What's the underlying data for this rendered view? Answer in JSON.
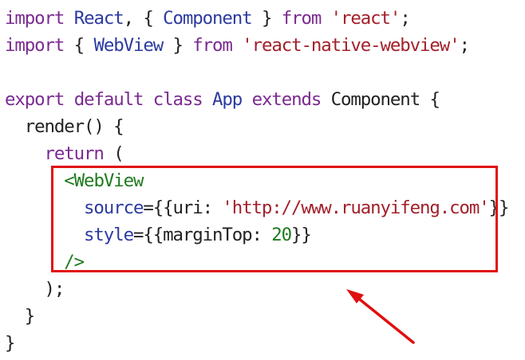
{
  "code": {
    "lines": [
      {
        "tokens": [
          {
            "t": "import",
            "c": "kw"
          },
          {
            "t": " ",
            "c": "plain"
          },
          {
            "t": "React",
            "c": "id"
          },
          {
            "t": ", { ",
            "c": "plain"
          },
          {
            "t": "Component",
            "c": "id"
          },
          {
            "t": " } ",
            "c": "plain"
          },
          {
            "t": "from",
            "c": "kw"
          },
          {
            "t": " ",
            "c": "plain"
          },
          {
            "t": "'react'",
            "c": "str"
          },
          {
            "t": ";",
            "c": "plain"
          }
        ]
      },
      {
        "tokens": [
          {
            "t": "import",
            "c": "kw"
          },
          {
            "t": " { ",
            "c": "plain"
          },
          {
            "t": "WebView",
            "c": "id"
          },
          {
            "t": " } ",
            "c": "plain"
          },
          {
            "t": "from",
            "c": "kw"
          },
          {
            "t": " ",
            "c": "plain"
          },
          {
            "t": "'react-native-webview'",
            "c": "str"
          },
          {
            "t": ";",
            "c": "plain"
          }
        ]
      },
      {
        "tokens": []
      },
      {
        "tokens": [
          {
            "t": "export",
            "c": "kw"
          },
          {
            "t": " ",
            "c": "plain"
          },
          {
            "t": "default",
            "c": "kw"
          },
          {
            "t": " ",
            "c": "plain"
          },
          {
            "t": "class",
            "c": "kw"
          },
          {
            "t": " ",
            "c": "plain"
          },
          {
            "t": "App",
            "c": "id"
          },
          {
            "t": " ",
            "c": "plain"
          },
          {
            "t": "extends",
            "c": "kw"
          },
          {
            "t": " Component {",
            "c": "plain"
          }
        ]
      },
      {
        "tokens": [
          {
            "t": "  render() {",
            "c": "plain"
          }
        ]
      },
      {
        "tokens": [
          {
            "t": "    ",
            "c": "plain"
          },
          {
            "t": "return",
            "c": "kw"
          },
          {
            "t": " (",
            "c": "plain"
          }
        ]
      },
      {
        "tokens": [
          {
            "t": "      ",
            "c": "plain"
          },
          {
            "t": "<WebView",
            "c": "tag"
          }
        ]
      },
      {
        "tokens": [
          {
            "t": "        ",
            "c": "plain"
          },
          {
            "t": "source",
            "c": "attr"
          },
          {
            "t": "={{uri: ",
            "c": "plain"
          },
          {
            "t": "'http://www.ruanyifeng.com'",
            "c": "str"
          },
          {
            "t": "}}",
            "c": "plain"
          }
        ]
      },
      {
        "tokens": [
          {
            "t": "        ",
            "c": "plain"
          },
          {
            "t": "style",
            "c": "attr"
          },
          {
            "t": "={{marginTop: ",
            "c": "plain"
          },
          {
            "t": "20",
            "c": "num"
          },
          {
            "t": "}}",
            "c": "plain"
          }
        ]
      },
      {
        "tokens": [
          {
            "t": "      ",
            "c": "plain"
          },
          {
            "t": "/>",
            "c": "tag"
          }
        ]
      },
      {
        "tokens": [
          {
            "t": "    );",
            "c": "plain"
          }
        ]
      },
      {
        "tokens": [
          {
            "t": "  }",
            "c": "plain"
          }
        ]
      },
      {
        "tokens": [
          {
            "t": "}",
            "c": "plain"
          }
        ]
      }
    ]
  },
  "annotation": {
    "box_color": "#e01010",
    "arrow_color": "#e01010"
  },
  "colors": {
    "keyword": "#7a2b8f",
    "identifier": "#2c3aa0",
    "string": "#a3202a",
    "tag": "#1f7a1f",
    "number": "#1f7a1f",
    "text": "#222222"
  }
}
